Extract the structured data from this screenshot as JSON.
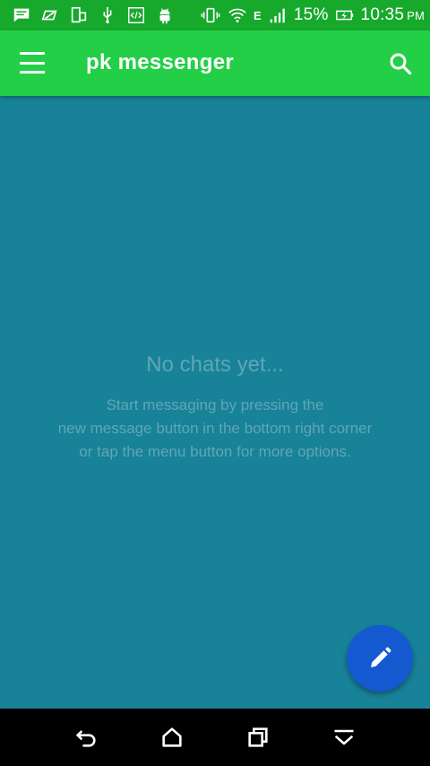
{
  "status_bar": {
    "icons_left": [
      "message-notification-icon",
      "eye-off-icon",
      "screen-rotation-icon",
      "usb-icon",
      "developer-icon",
      "android-icon"
    ],
    "icons_right": [
      "vibrate-icon",
      "wifi-icon",
      "signal-icon",
      "battery-charging-icon"
    ],
    "network_type": "E",
    "battery_percent": "15%",
    "time": "10:35",
    "ampm": "PM"
  },
  "app_bar": {
    "title": "pk messenger",
    "color": "#23cf47",
    "menu_icon": "menu-icon",
    "search_icon": "search-icon"
  },
  "empty_state": {
    "title": "No chats yet...",
    "lines": [
      "Start messaging by pressing the",
      "new message button in the bottom right corner",
      "or tap the menu button for more options."
    ]
  },
  "fab": {
    "icon": "pencil-icon",
    "color": "#1459cf"
  },
  "background_color": "#188298",
  "nav_bar": {
    "buttons": [
      "back-icon",
      "home-icon",
      "recents-icon",
      "hide-keyboard-icon"
    ]
  }
}
